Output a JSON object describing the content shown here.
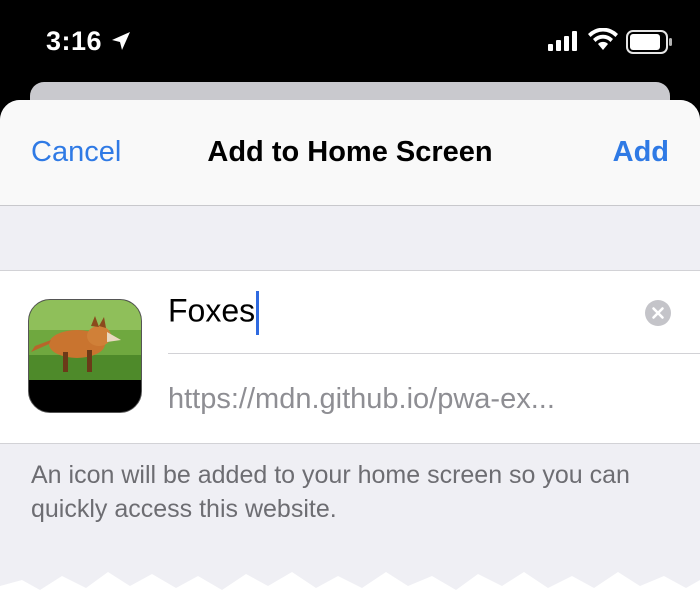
{
  "status_bar": {
    "time": "3:16",
    "icons": [
      "location-arrow-icon",
      "cellular-signal-icon",
      "wifi-icon",
      "battery-icon"
    ]
  },
  "navbar": {
    "cancel_label": "Cancel",
    "title": "Add to Home Screen",
    "add_label": "Add"
  },
  "form": {
    "app_name": "Foxes",
    "url": "https://mdn.github.io/pwa-ex...",
    "icon": "fox-app-icon"
  },
  "footer": {
    "note": "An icon will be added to your home screen so you can quickly access this website."
  },
  "colors": {
    "accent": "#2f7ae5",
    "sheet_background": "#efeff4",
    "secondary_text": "#8e8e93",
    "footer_text": "#6d6d72"
  }
}
